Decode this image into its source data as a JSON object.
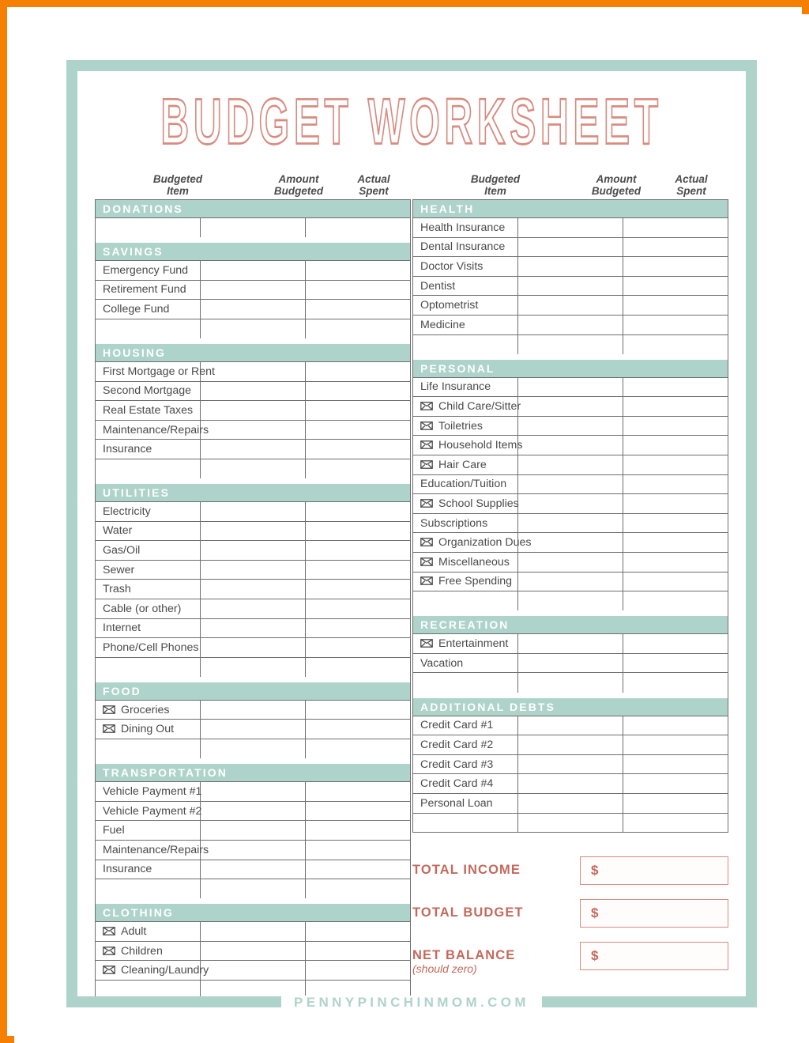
{
  "document": {
    "title": "BUDGET WORKSHEET",
    "footer": "PENNYPINCHINMOM.COM"
  },
  "colors": {
    "sage": "#aed3ca",
    "salmon": "#c4695c",
    "salmon_light": "#d98b80",
    "page_border_orange": "#f77f00",
    "text_gray": "#4a4a4a"
  },
  "column_headers": {
    "item": "Budgeted\nItem",
    "item_line1": "Budgeted",
    "item_line2": "Item",
    "amount_line1": "Amount",
    "amount_line2": "Budgeted",
    "actual_line1": "Actual",
    "actual_line2": "Spent"
  },
  "left_column": [
    {
      "section": "DONATIONS",
      "items": [],
      "trailing_blank_rows": 1
    },
    {
      "section": "SAVINGS",
      "items": [
        {
          "label": "Emergency Fund",
          "envelope": false
        },
        {
          "label": "Retirement Fund",
          "envelope": false
        },
        {
          "label": "College Fund",
          "envelope": false
        }
      ],
      "trailing_blank_rows": 1
    },
    {
      "section": "HOUSING",
      "items": [
        {
          "label": "First Mortgage or Rent",
          "envelope": false
        },
        {
          "label": "Second Mortgage",
          "envelope": false
        },
        {
          "label": "Real Estate Taxes",
          "envelope": false
        },
        {
          "label": "Maintenance/Repairs",
          "envelope": false
        },
        {
          "label": "Insurance",
          "envelope": false
        }
      ],
      "trailing_blank_rows": 1
    },
    {
      "section": "UTILITIES",
      "items": [
        {
          "label": "Electricity",
          "envelope": false
        },
        {
          "label": "Water",
          "envelope": false
        },
        {
          "label": "Gas/Oil",
          "envelope": false
        },
        {
          "label": "Sewer",
          "envelope": false
        },
        {
          "label": "Trash",
          "envelope": false
        },
        {
          "label": "Cable (or other)",
          "envelope": false
        },
        {
          "label": "Internet",
          "envelope": false
        },
        {
          "label": "Phone/Cell Phones",
          "envelope": false
        }
      ],
      "trailing_blank_rows": 1
    },
    {
      "section": "FOOD",
      "items": [
        {
          "label": "Groceries",
          "envelope": true
        },
        {
          "label": "Dining Out",
          "envelope": true
        }
      ],
      "trailing_blank_rows": 1
    },
    {
      "section": "TRANSPORTATION",
      "items": [
        {
          "label": "Vehicle Payment #1",
          "envelope": false
        },
        {
          "label": "Vehicle Payment #2",
          "envelope": false
        },
        {
          "label": "Fuel",
          "envelope": false
        },
        {
          "label": "Maintenance/Repairs",
          "envelope": false
        },
        {
          "label": "Insurance",
          "envelope": false
        }
      ],
      "trailing_blank_rows": 1
    },
    {
      "section": "CLOTHING",
      "items": [
        {
          "label": "Adult",
          "envelope": true
        },
        {
          "label": "Children",
          "envelope": true
        },
        {
          "label": "Cleaning/Laundry",
          "envelope": true
        }
      ],
      "trailing_blank_rows": 1
    }
  ],
  "right_column": [
    {
      "section": "HEALTH",
      "items": [
        {
          "label": "Health Insurance",
          "envelope": false
        },
        {
          "label": "Dental Insurance",
          "envelope": false
        },
        {
          "label": "Doctor Visits",
          "envelope": false
        },
        {
          "label": "Dentist",
          "envelope": false
        },
        {
          "label": "Optometrist",
          "envelope": false
        },
        {
          "label": "Medicine",
          "envelope": false
        }
      ],
      "trailing_blank_rows": 1
    },
    {
      "section": "PERSONAL",
      "items": [
        {
          "label": "Life Insurance",
          "envelope": false
        },
        {
          "label": "Child Care/Sitter",
          "envelope": true
        },
        {
          "label": "Toiletries",
          "envelope": true
        },
        {
          "label": "Household Items",
          "envelope": true
        },
        {
          "label": "Hair Care",
          "envelope": true
        },
        {
          "label": "Education/Tuition",
          "envelope": false
        },
        {
          "label": "School Supplies",
          "envelope": true
        },
        {
          "label": "Subscriptions",
          "envelope": false
        },
        {
          "label": "Organization Dues",
          "envelope": true
        },
        {
          "label": "Miscellaneous",
          "envelope": true
        },
        {
          "label": "Free Spending",
          "envelope": true
        }
      ],
      "trailing_blank_rows": 1
    },
    {
      "section": "RECREATION",
      "items": [
        {
          "label": "Entertainment",
          "envelope": true
        },
        {
          "label": "Vacation",
          "envelope": false
        }
      ],
      "trailing_blank_rows": 1
    },
    {
      "section": "ADDITIONAL DEBTS",
      "items": [
        {
          "label": "Credit Card #1",
          "envelope": false
        },
        {
          "label": "Credit Card #2",
          "envelope": false
        },
        {
          "label": "Credit Card #3",
          "envelope": false
        },
        {
          "label": "Credit Card #4",
          "envelope": false
        },
        {
          "label": "Personal Loan",
          "envelope": false
        }
      ],
      "trailing_blank_rows": 1
    }
  ],
  "totals": [
    {
      "label": "TOTAL INCOME",
      "sub": "",
      "currency": "$",
      "value": ""
    },
    {
      "label": "TOTAL BUDGET",
      "sub": "",
      "currency": "$",
      "value": ""
    },
    {
      "label": "NET BALANCE",
      "sub": "(should zero)",
      "currency": "$",
      "value": ""
    }
  ]
}
